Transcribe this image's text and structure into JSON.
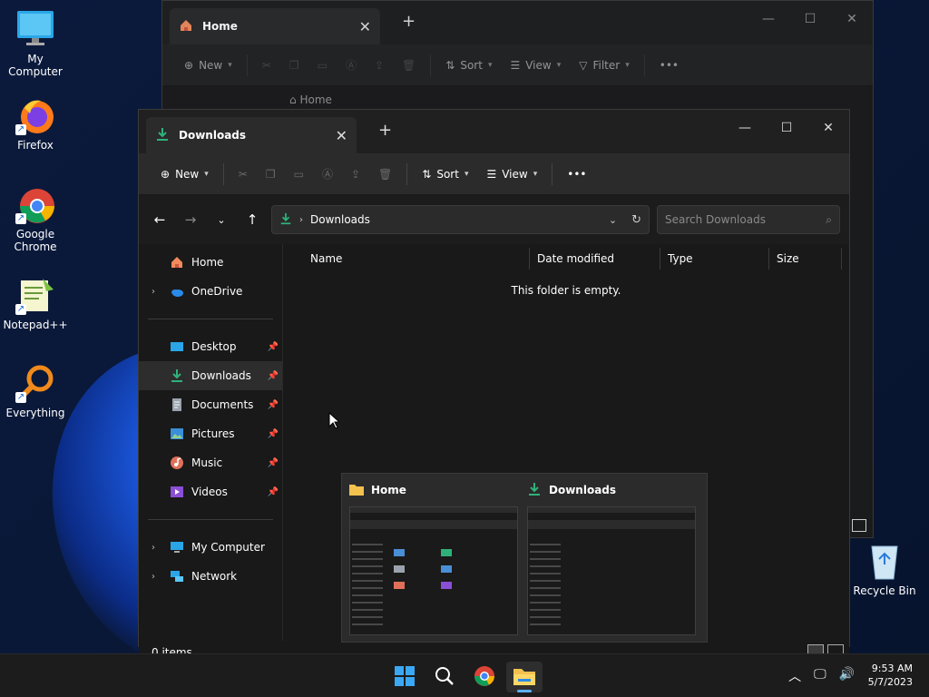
{
  "desktop": {
    "icons": [
      {
        "label": "My Computer"
      },
      {
        "label": "Firefox"
      },
      {
        "label": "Google Chrome"
      },
      {
        "label": "Notepad++"
      },
      {
        "label": "Everything"
      },
      {
        "label": "Recycle Bin"
      }
    ]
  },
  "back_window": {
    "tab_title": "Home",
    "toolbar": {
      "new_label": "New",
      "sort_label": "Sort",
      "view_label": "View",
      "filter_label": "Filter"
    },
    "path": "Home"
  },
  "front_window": {
    "tab_title": "Downloads",
    "toolbar": {
      "new_label": "New",
      "sort_label": "Sort",
      "view_label": "View"
    },
    "address": {
      "path": "Downloads"
    },
    "search": {
      "placeholder": "Search Downloads"
    },
    "nav": {
      "top": [
        {
          "label": "Home"
        },
        {
          "label": "OneDrive"
        }
      ],
      "pinned": [
        {
          "label": "Desktop"
        },
        {
          "label": "Downloads"
        },
        {
          "label": "Documents"
        },
        {
          "label": "Pictures"
        },
        {
          "label": "Music"
        },
        {
          "label": "Videos"
        }
      ],
      "bottom": [
        {
          "label": "My Computer"
        },
        {
          "label": "Network"
        }
      ]
    },
    "columns": [
      "Name",
      "Date modified",
      "Type",
      "Size"
    ],
    "empty_message": "This folder is empty.",
    "status": "0 items"
  },
  "thumbnails": [
    {
      "title": "Home"
    },
    {
      "title": "Downloads"
    }
  ],
  "taskbar": {
    "time": "9:53 AM",
    "date": "5/7/2023"
  },
  "colors": {
    "accent": "#5ab0ff",
    "download_green": "#2fb27a",
    "folder_yellow": "#f2c14e"
  }
}
